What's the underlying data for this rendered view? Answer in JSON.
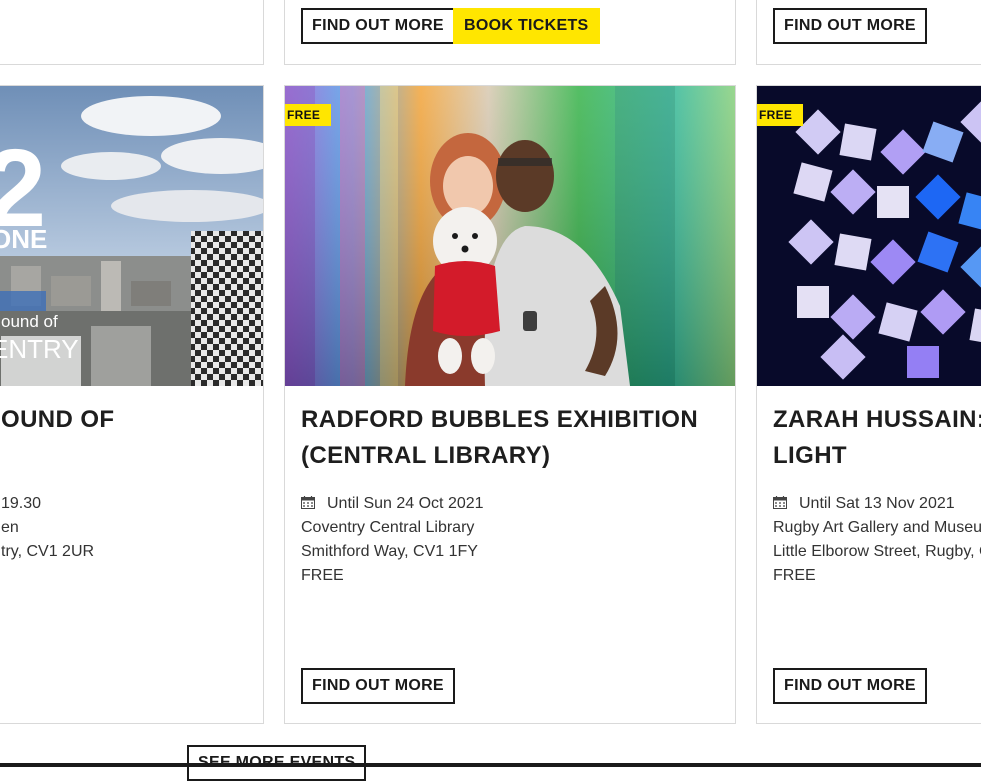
{
  "top_row": {
    "card2": {
      "find_out_more": "FIND OUT MORE",
      "book_tickets": "BOOK TICKETS"
    },
    "card3": {
      "find_out_more": "FIND OUT MORE"
    }
  },
  "events": [
    {
      "image_text": {
        "number": "2",
        "one": "ONE",
        "sound_of": "ound of",
        "city": "ENTRY"
      },
      "title_lines": [
        "OUND OF",
        ""
      ],
      "date": "19.30",
      "venue": "en",
      "address": "try, CV1 2UR",
      "price": ""
    },
    {
      "badge": "FREE",
      "title_lines": [
        "RADFORD BUBBLES EXHIBITION",
        "(CENTRAL LIBRARY)"
      ],
      "date": "Until Sun 24 Oct 2021",
      "venue": "Coventry Central Library",
      "address": "Smithford Way, CV1 1FY",
      "price": "FREE",
      "button": "FIND OUT MORE"
    },
    {
      "badge": "FREE",
      "title_lines": [
        "ZARAH HUSSAIN: L",
        "LIGHT"
      ],
      "date": "Until Sat 13 Nov 2021",
      "venue": "Rugby Art Gallery and Museum",
      "address": "Little Elborow Street, Rugby, C",
      "price": "FREE",
      "button": "FIND OUT MORE"
    }
  ],
  "see_more": "SEE MORE EVENTS",
  "colors": {
    "accent_yellow": "#ffe600",
    "text": "#1a1a1a",
    "border": "#d9d9d9"
  },
  "icons": [
    "calendar-icon"
  ]
}
